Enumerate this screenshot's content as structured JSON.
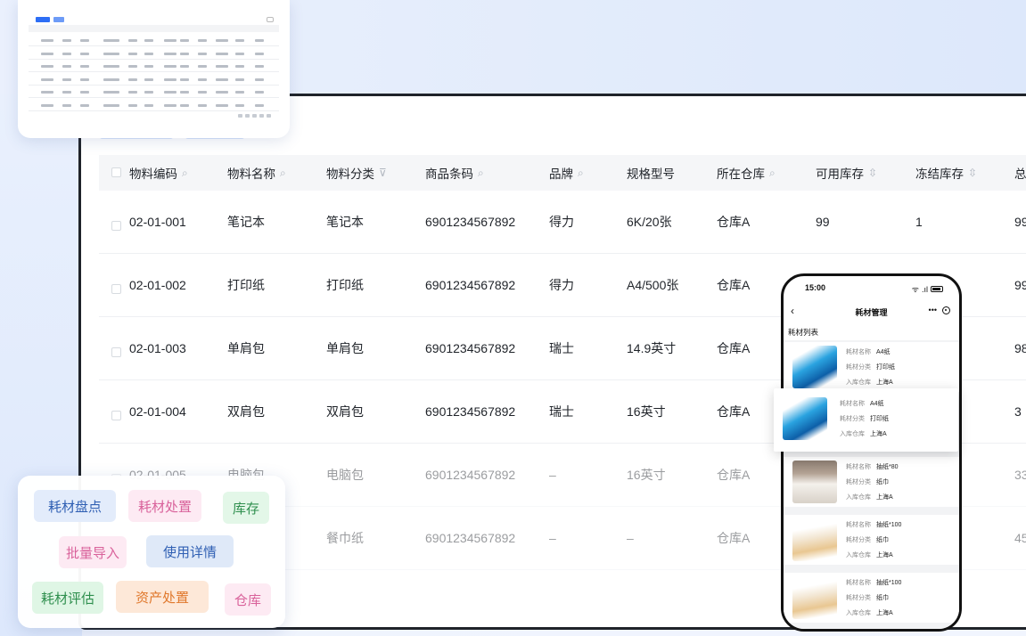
{
  "thumbnail": {
    "label": "table preview thumbnail"
  },
  "table": {
    "columns": [
      {
        "label": "物料编码",
        "icon": "search-icon"
      },
      {
        "label": "物料名称",
        "icon": "search-icon"
      },
      {
        "label": "物料分类",
        "icon": "filter-icon"
      },
      {
        "label": "商品条码",
        "icon": "search-icon"
      },
      {
        "label": "品牌",
        "icon": "search-icon"
      },
      {
        "label": "规格型号",
        "icon": ""
      },
      {
        "label": "所在仓库",
        "icon": "search-icon"
      },
      {
        "label": "可用库存",
        "icon": "sort-icon"
      },
      {
        "label": "冻结库存",
        "icon": "sort-icon"
      },
      {
        "label": "总",
        "icon": ""
      }
    ],
    "rows": [
      {
        "code": "02-01-001",
        "name": "笔记本",
        "category": "笔记本",
        "barcode": "6901234567892",
        "brand": "得力",
        "spec": "6K/20张",
        "warehouse": "仓库A",
        "available": "99",
        "frozen": "1",
        "total": "99"
      },
      {
        "code": "02-01-002",
        "name": "打印纸",
        "category": "打印纸",
        "barcode": "6901234567892",
        "brand": "得力",
        "spec": "A4/500张",
        "warehouse": "仓库A",
        "available": "",
        "frozen": "",
        "total": "99"
      },
      {
        "code": "02-01-003",
        "name": "单肩包",
        "category": "单肩包",
        "barcode": "6901234567892",
        "brand": "瑞士",
        "spec": "14.9英寸",
        "warehouse": "仓库A",
        "available": "",
        "frozen": "",
        "total": "98"
      },
      {
        "code": "02-01-004",
        "name": "双肩包",
        "category": "双肩包",
        "barcode": "6901234567892",
        "brand": "瑞士",
        "spec": "16英寸",
        "warehouse": "仓库A",
        "available": "",
        "frozen": "",
        "total": "3"
      },
      {
        "code": "02-01-005",
        "name": "电脑包",
        "category": "电脑包",
        "barcode": "6901234567892",
        "brand": "–",
        "spec": "16英寸",
        "warehouse": "仓库A",
        "available": "",
        "frozen": "",
        "total": "33"
      },
      {
        "code": "",
        "name": "",
        "category": "餐巾纸",
        "barcode": "6901234567892",
        "brand": "–",
        "spec": "–",
        "warehouse": "仓库A",
        "available": "",
        "frozen": "",
        "total": "45"
      }
    ]
  },
  "tags": [
    {
      "label": "耗材盘点",
      "color": "#2f5fb3",
      "bg": "#e3ecfb"
    },
    {
      "label": "耗材处置",
      "color": "#d9629b",
      "bg": "#fdeaf3"
    },
    {
      "label": "库存",
      "color": "#2f8f4e",
      "bg": "#e3f7e8"
    },
    {
      "label": "批量导入",
      "color": "#d9629b",
      "bg": "#fdeaf3"
    },
    {
      "label": "使用详情",
      "color": "#2f5fb3",
      "bg": "#dfe9f8"
    },
    {
      "label": "耗材评估",
      "color": "#2f8f4e",
      "bg": "#dff6e5"
    },
    {
      "label": "资产处置",
      "color": "#e0782c",
      "bg": "#fde8d8"
    },
    {
      "label": "仓库",
      "color": "#d9629b",
      "bg": "#fdeaf3"
    }
  ],
  "phone": {
    "time": "15:00",
    "title": "耗材管理",
    "back": "‹",
    "more": "•••",
    "subtitle": "耗材列表",
    "field_name": "耗材名称",
    "field_category": "耗材分类",
    "field_warehouse": "入库仓库",
    "items": [
      {
        "name": "A4纸",
        "category": "打印纸",
        "warehouse": "上海A"
      },
      {
        "name": "A4纸",
        "category": "打印纸",
        "warehouse": "上海A"
      },
      {
        "name": "抽纸*80",
        "category": "纸巾",
        "warehouse": "上海A"
      },
      {
        "name": "抽纸*100",
        "category": "纸巾",
        "warehouse": "上海A"
      },
      {
        "name": "抽纸*100",
        "category": "纸巾",
        "warehouse": "上海A"
      }
    ]
  }
}
